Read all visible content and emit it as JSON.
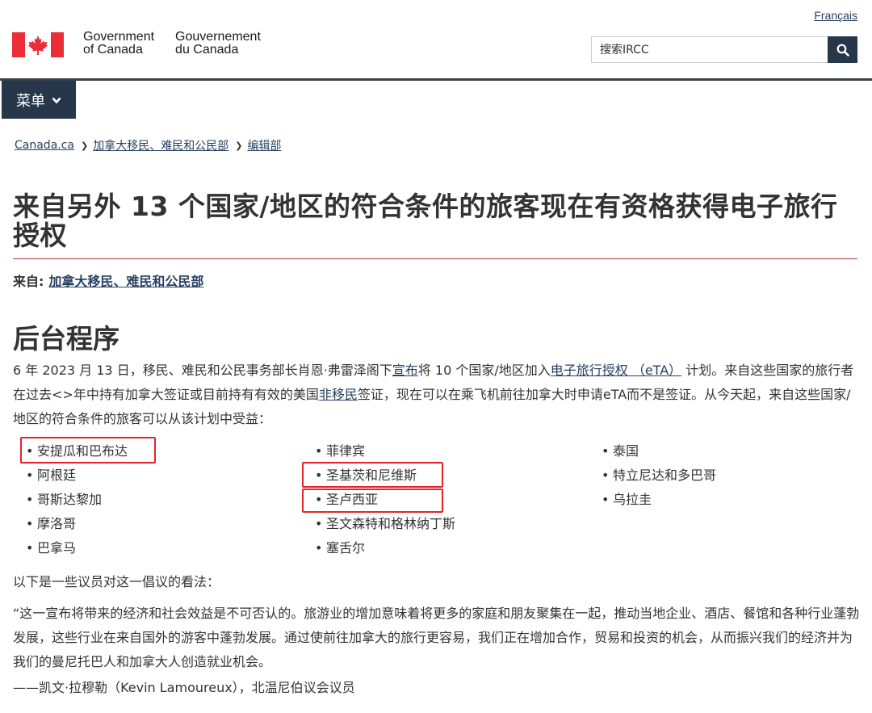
{
  "header": {
    "language_toggle": "Français",
    "brand_en_line1": "Government",
    "brand_en_line2": "of Canada",
    "brand_fr_line1": "Gouvernement",
    "brand_fr_line2": "du Canada",
    "search_placeholder": "搜索IRCC",
    "menu_label": "菜单"
  },
  "breadcrumb": [
    "Canada.ca",
    "加拿大移民、难民和公民部",
    "编辑部"
  ],
  "article": {
    "title": "来自另外 13 个国家/地区的符合条件的旅客现在有资格获得电子旅行授权",
    "from_label": "来自:",
    "from_link": "加拿大移民、难民和公民部",
    "section_heading": "后台程序",
    "para1": {
      "t1": "6 年 2023 月 13 日，移民、难民和公民事务部长肖恩·弗雷泽阁下",
      "link1": "宣布",
      "t2": "将 10 个国家/地区加入",
      "link2": "电子旅行授权 （eTA）",
      "t3": " 计划。来自这些国家的旅行者在过去<>年中持有加拿大签证或目前持有有效的美国",
      "link3": "非移民",
      "t4": "签证，现在可以在乘飞机前往加拿大时申请eTA而不是签证。从今天起，来自这些国家/地区的符合条件的旅客可以从该计划中受益："
    },
    "countries_col1": [
      "安提瓜和巴布达",
      "阿根廷",
      "哥斯达黎加",
      "摩洛哥",
      "巴拿马"
    ],
    "countries_col2": [
      "菲律宾",
      "圣基茨和尼维斯",
      "圣卢西亚",
      "圣文森特和格林纳丁斯",
      "塞舌尔"
    ],
    "countries_col3": [
      "泰国",
      "特立尼达和多巴哥",
      "乌拉圭"
    ],
    "para2": "以下是一些议员对这一倡议的看法：",
    "quote": "“这一宣布将带来的经济和社会效益是不可否认的。旅游业的增加意味着将更多的家庭和朋友聚集在一起，推动当地企业、酒店、餐馆和各种行业蓬勃发展，这些行业在来自国外的游客中蓬勃发展。通过使前往加拿大的旅行更容易，我们正在增加合作，贸易和投资的机会，从而振兴我们的经济并为我们的曼尼托巴人和加拿大人创造就业机会。",
    "attribution": "——凯文·拉穆勒（Kevin Lamoureux），北温尼伯议会议员"
  },
  "colors": {
    "nav_dark": "#26374a",
    "link": "#284162",
    "flag_red": "#eb2d37",
    "title_rule": "#af3c43",
    "highlight_box": "#e8222a"
  }
}
